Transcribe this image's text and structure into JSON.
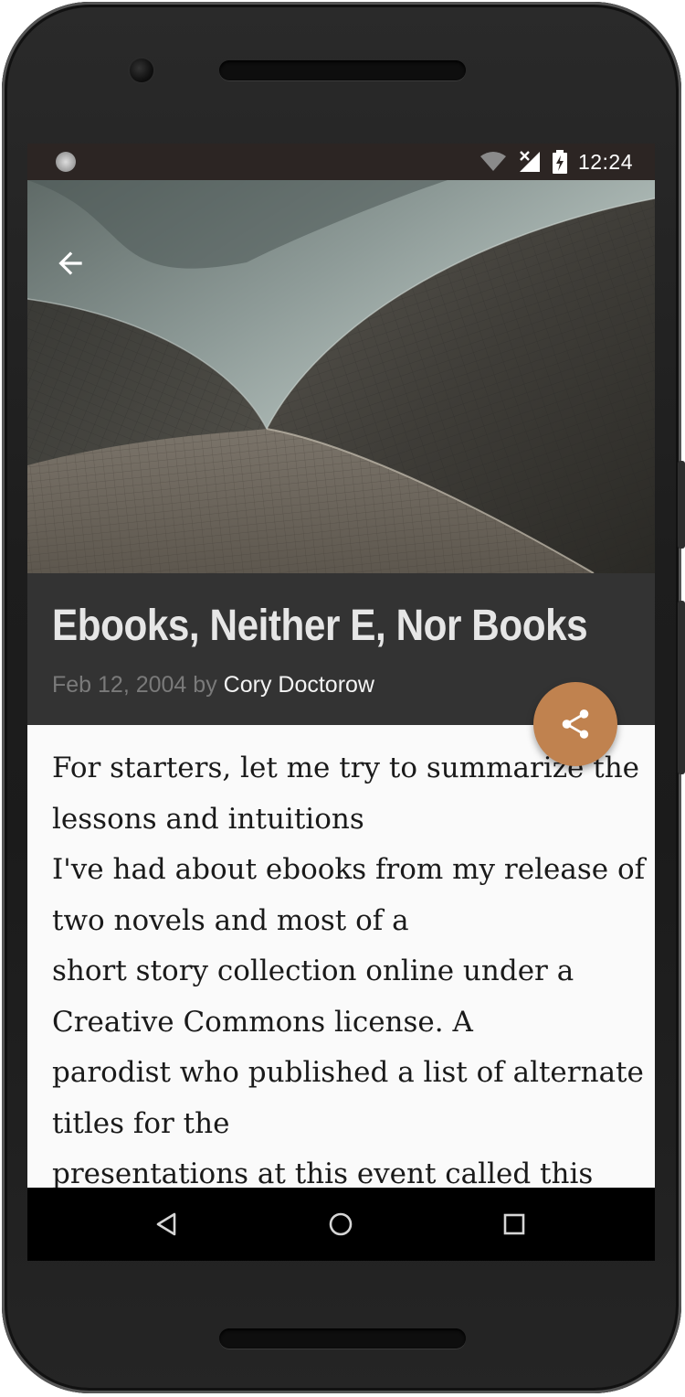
{
  "status_bar": {
    "time": "12:24",
    "icons": [
      "notification-dot-icon",
      "wifi-icon",
      "cellular-no-signal-icon",
      "battery-charging-icon"
    ]
  },
  "hero": {
    "image_description_icon": "architecture-photo",
    "back_icon": "arrow-back-icon"
  },
  "article": {
    "title": "Ebooks, Neither E, Nor Books",
    "date": "Feb 12, 2004",
    "by": "by",
    "author": "Cory Doctorow",
    "share_icon": "share-icon",
    "body_lines": [
      "For starters, let me try to summarize the",
      "lessons and intuitions",
      "I've had about ebooks from my release of",
      "two novels and most of a",
      "short story collection online under a",
      "Creative Commons license. A",
      "parodist who published a list of alternate",
      "titles for the",
      "presentations at this event called this"
    ]
  },
  "nav_bar": {
    "back_icon": "nav-back-triangle-icon",
    "home_icon": "nav-home-circle-icon",
    "recents_icon": "nav-recents-square-icon"
  },
  "colors": {
    "status_bar": "#2c2523",
    "header_bg": "#333333",
    "fab": "#c0824f",
    "body_bg": "#fafafa"
  }
}
